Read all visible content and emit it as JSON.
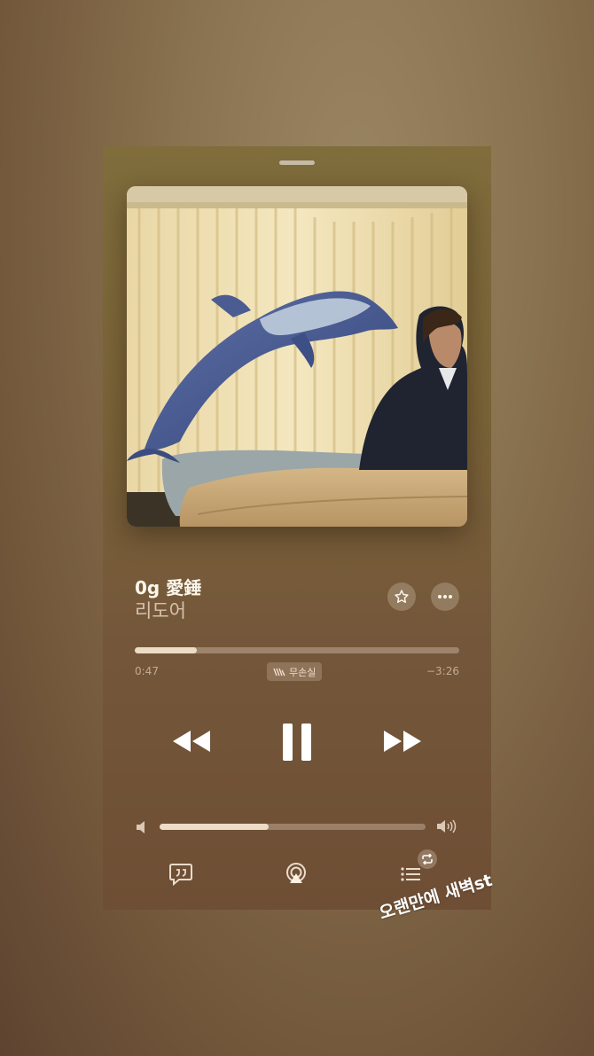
{
  "track": {
    "title": "0g 愛錘",
    "artist": "리도어"
  },
  "playback": {
    "elapsed": "0:47",
    "remaining": "−3:26",
    "progress_fraction": 0.19,
    "lossless_label": "무손실",
    "state": "playing"
  },
  "volume": {
    "level_fraction": 0.41
  },
  "icons": {
    "favorite": "star-icon",
    "more": "ellipsis-icon",
    "rewind": "rewind-icon",
    "pause": "pause-icon",
    "forward": "fast-forward-icon",
    "volume_low": "speaker-low-icon",
    "volume_high": "speaker-high-icon",
    "lyrics": "lyrics-icon",
    "airplay": "airplay-icon",
    "queue": "queue-list-icon",
    "repeat": "repeat-icon"
  },
  "sticker": {
    "text": "오랜만에 새벽st"
  },
  "colors": {
    "background": "#8a7350",
    "card": "#7a6338",
    "accent": "#ecdcc8"
  }
}
